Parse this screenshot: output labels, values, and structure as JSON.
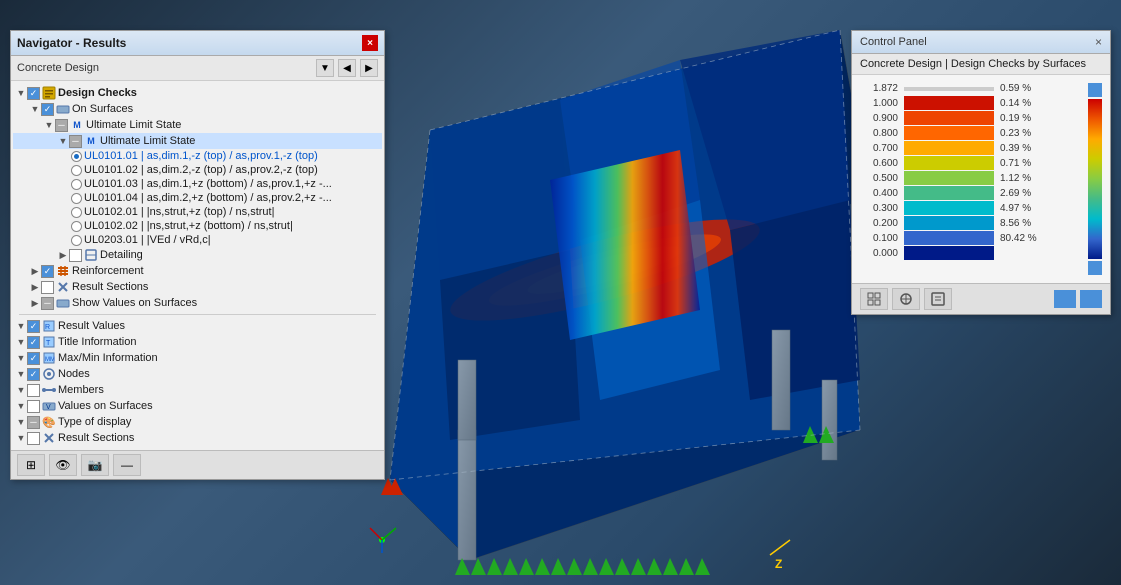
{
  "navigator": {
    "title": "Navigator - Results",
    "close_label": "×",
    "toolbar": {
      "label": "Concrete Design",
      "nav_prev": "◀",
      "nav_next": "▶",
      "expand": "▼"
    },
    "tree": [
      {
        "id": "design-checks",
        "label": "Design Checks",
        "indent": 0,
        "toggle": "▼",
        "checkbox": "checked",
        "icon": "folder",
        "bold": true
      },
      {
        "id": "on-surfaces",
        "label": "On Surfaces",
        "indent": 1,
        "toggle": "▼",
        "checkbox": "checked",
        "icon": "surface"
      },
      {
        "id": "uls-parent",
        "label": "Ultimate Limit State",
        "indent": 2,
        "toggle": "▼",
        "checkbox": "partial",
        "icon": "M"
      },
      {
        "id": "uls-child",
        "label": "Ultimate Limit State",
        "indent": 3,
        "toggle": "▼",
        "checkbox": "partial",
        "icon": "M",
        "selected": true
      },
      {
        "id": "ul0101-01",
        "label": "UL0101.01 | as,dim.1,-z (top) / as,prov.1,-z (top)",
        "indent": 4,
        "radio": "filled",
        "blue": true
      },
      {
        "id": "ul0101-02",
        "label": "UL0101.02 | as,dim.2,-z (top) / as,prov.2,-z (top)",
        "indent": 4,
        "radio": "empty"
      },
      {
        "id": "ul0101-03",
        "label": "UL0101.03 | as,dim.1,+z (bottom) / as,prov.1,+z -...",
        "indent": 4,
        "radio": "empty"
      },
      {
        "id": "ul0101-04",
        "label": "UL0101.04 | as,dim.2,+z (bottom) / as,prov.2,+z -...",
        "indent": 4,
        "radio": "empty"
      },
      {
        "id": "ul0102-01",
        "label": "UL0102.01 | |ns,strut,+z (top) / ns,strut|",
        "indent": 4,
        "radio": "empty"
      },
      {
        "id": "ul0102-02",
        "label": "UL0102.02 | |ns,strut,+z (bottom) / ns,strut|",
        "indent": 4,
        "radio": "empty"
      },
      {
        "id": "ul0203-01",
        "label": "UL0203.01 | |VEd / vRd,c|",
        "indent": 4,
        "radio": "empty"
      },
      {
        "id": "detailing",
        "label": "Detailing",
        "indent": 3,
        "toggle": "▶",
        "checkbox": "unchecked",
        "icon": "detail"
      },
      {
        "id": "reinforcement",
        "label": "Reinforcement",
        "indent": 1,
        "toggle": "▶",
        "checkbox": "checked",
        "icon": "reinf"
      },
      {
        "id": "result-sections",
        "label": "Result Sections",
        "indent": 1,
        "toggle": "▶",
        "checkbox": "unchecked",
        "icon": "section"
      },
      {
        "id": "show-values",
        "label": "Show Values on Surfaces",
        "indent": 1,
        "toggle": "▶",
        "checkbox": "partial",
        "icon": "surface2"
      }
    ],
    "divider": true,
    "tree2": [
      {
        "id": "result-values",
        "label": "Result Values",
        "indent": 0,
        "toggle": "▼",
        "checkbox": "checked",
        "icon": "rv"
      },
      {
        "id": "title-info",
        "label": "Title Information",
        "indent": 0,
        "toggle": "▼",
        "checkbox": "checked",
        "icon": "ti"
      },
      {
        "id": "maxmin-info",
        "label": "Max/Min Information",
        "indent": 0,
        "toggle": "▼",
        "checkbox": "checked",
        "icon": "mm"
      },
      {
        "id": "nodes",
        "label": "Nodes",
        "indent": 0,
        "toggle": "▼",
        "checkbox": "checked",
        "icon": "nd"
      },
      {
        "id": "members",
        "label": "Members",
        "indent": 0,
        "toggle": "▼",
        "checkbox": "unchecked",
        "icon": "mb"
      },
      {
        "id": "values-surfaces",
        "label": "Values on Surfaces",
        "indent": 0,
        "toggle": "▼",
        "checkbox": "unchecked",
        "icon": "vs"
      },
      {
        "id": "type-display",
        "label": "Type of display",
        "indent": 0,
        "toggle": "▼",
        "checkbox": "partial",
        "icon": "td"
      },
      {
        "id": "result-sections2",
        "label": "Result Sections",
        "indent": 0,
        "toggle": "▼",
        "checkbox": "unchecked",
        "icon": "rs"
      }
    ],
    "bottom_buttons": [
      "⊞",
      "👁",
      "🎥",
      "—"
    ]
  },
  "control_panel": {
    "title": "Control Panel",
    "close_label": "×",
    "subtitle": "Concrete Design | Design Checks by Surfaces",
    "legend": [
      {
        "value": "1.872",
        "color": "#cc0000",
        "pct": "0.59 %",
        "is_max": true
      },
      {
        "value": "1.000",
        "color": "#dd2200",
        "pct": "0.14 %"
      },
      {
        "value": "0.900",
        "color": "#ee5500",
        "pct": "0.19 %"
      },
      {
        "value": "0.800",
        "color": "#ff7700",
        "pct": "0.23 %"
      },
      {
        "value": "0.700",
        "color": "#ffaa00",
        "pct": "0.39 %"
      },
      {
        "value": "0.600",
        "color": "#ddcc00",
        "pct": "0.71 %"
      },
      {
        "value": "0.500",
        "color": "#99cc00",
        "pct": "1.12 %"
      },
      {
        "value": "0.400",
        "color": "#55cc55",
        "pct": "2.69 %"
      },
      {
        "value": "0.300",
        "color": "#00ccaa",
        "pct": "4.97 %"
      },
      {
        "value": "0.200",
        "color": "#00aacc",
        "pct": "8.56 %"
      },
      {
        "value": "0.100",
        "color": "#0066cc",
        "pct": "80.42 %"
      },
      {
        "value": "0.000",
        "color": "#002299",
        "pct": ""
      }
    ],
    "indicator_color": "#4a90d9",
    "bottom_buttons": [
      "⊞",
      "⚖",
      "📋",
      ""
    ]
  },
  "icons": {
    "folder": "📁",
    "surface": "⬜",
    "M_icon": "M",
    "detail": "⬜",
    "reinf": "⬜",
    "section": "⬜"
  }
}
